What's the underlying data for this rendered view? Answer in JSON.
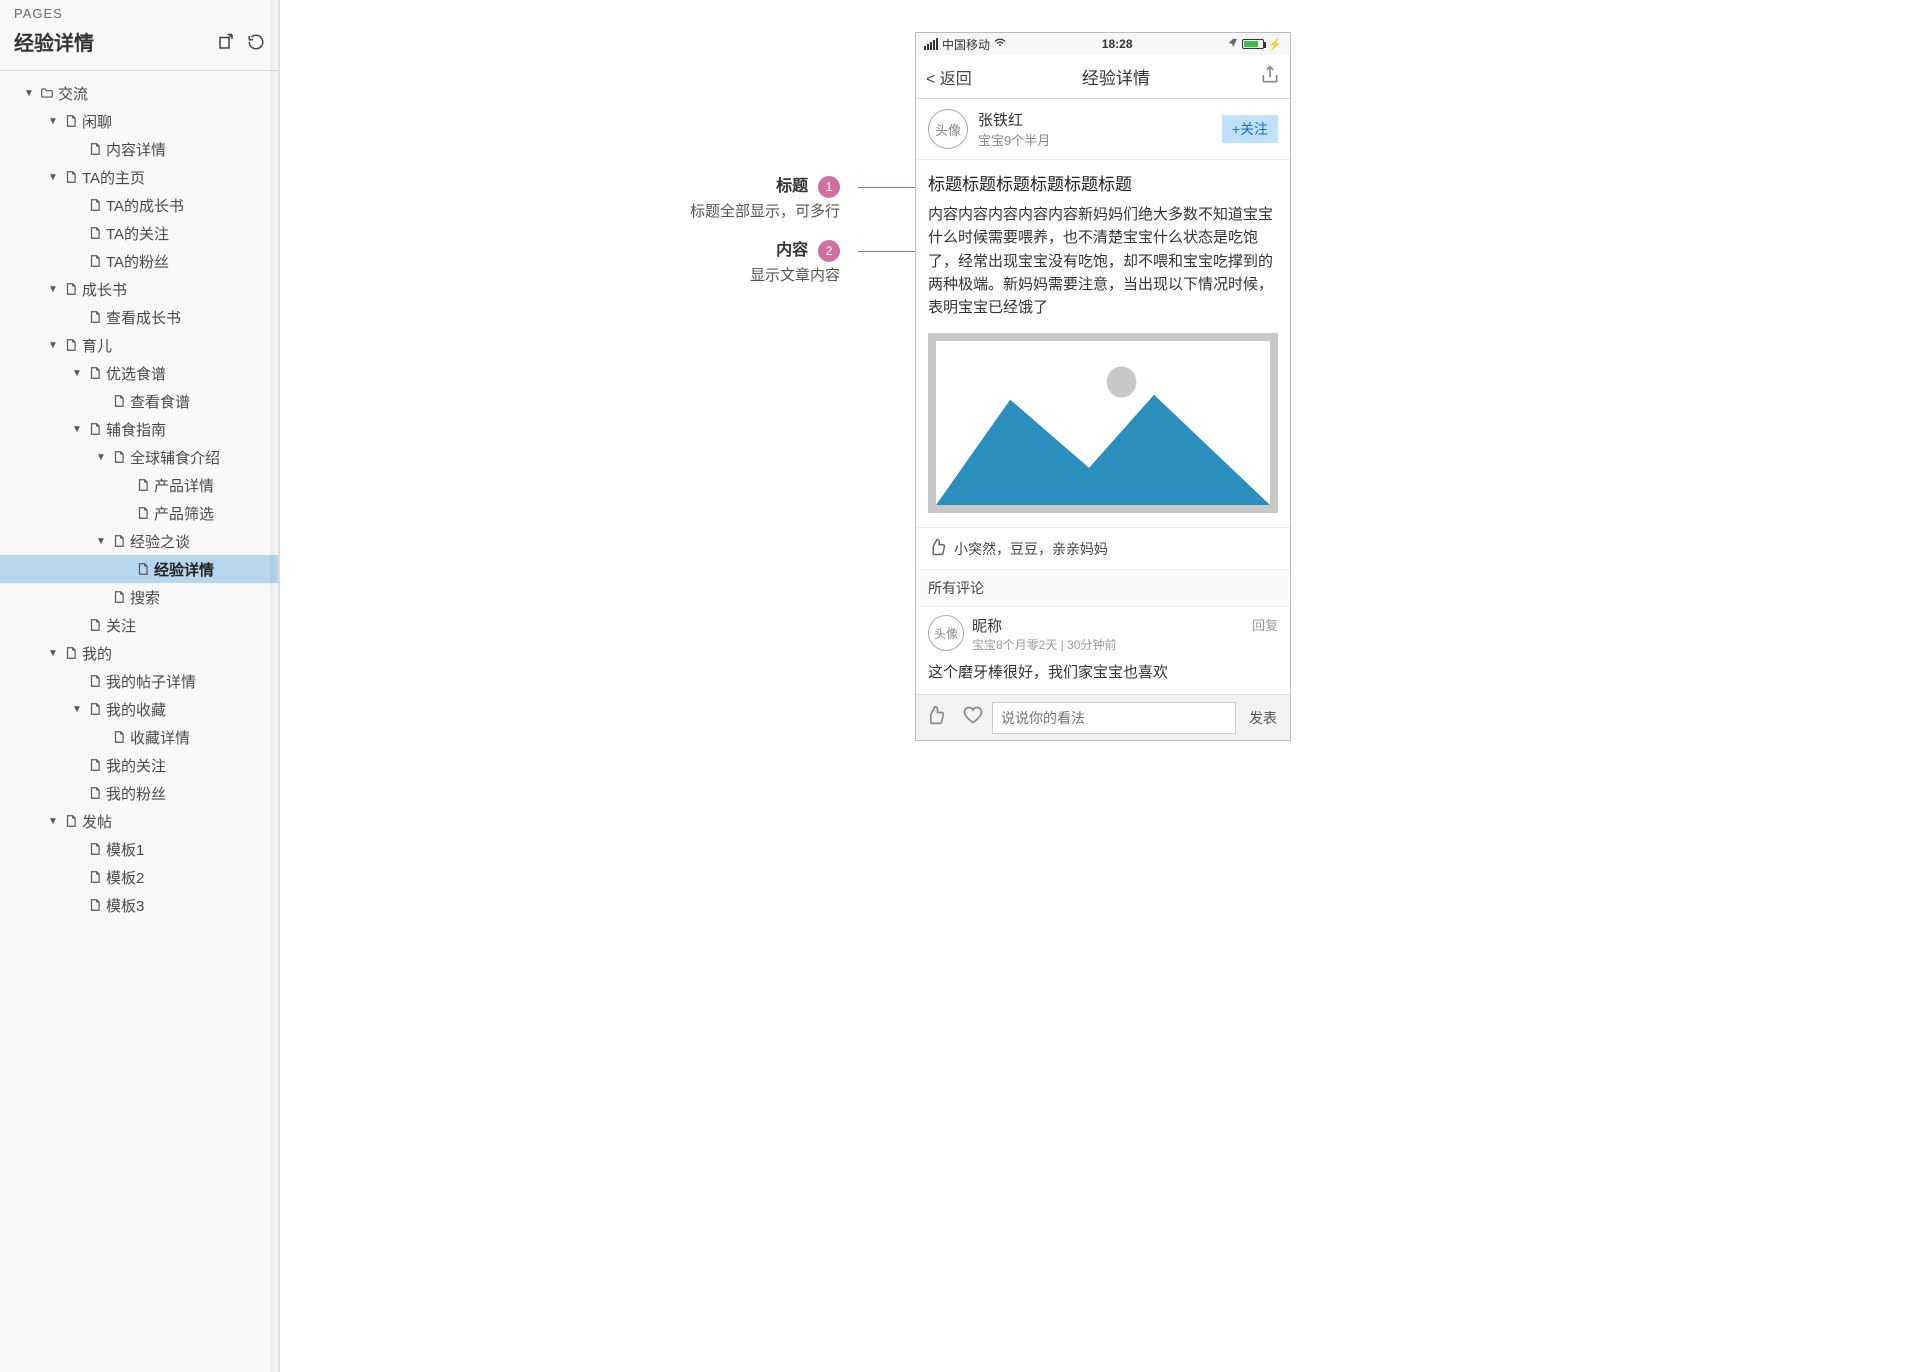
{
  "sidebar": {
    "pages_label": "PAGES",
    "page_title": "经验详情",
    "tree": [
      {
        "depth": 0,
        "caret": true,
        "kind": "folder",
        "label": "交流"
      },
      {
        "depth": 1,
        "caret": true,
        "kind": "page",
        "label": "闲聊"
      },
      {
        "depth": 2,
        "caret": false,
        "kind": "page",
        "label": "内容详情"
      },
      {
        "depth": 1,
        "caret": true,
        "kind": "page",
        "label": "TA的主页"
      },
      {
        "depth": 2,
        "caret": false,
        "kind": "page",
        "label": "TA的成长书"
      },
      {
        "depth": 2,
        "caret": false,
        "kind": "page",
        "label": "TA的关注"
      },
      {
        "depth": 2,
        "caret": false,
        "kind": "page",
        "label": "TA的粉丝"
      },
      {
        "depth": 1,
        "caret": true,
        "kind": "page",
        "label": "成长书"
      },
      {
        "depth": 2,
        "caret": false,
        "kind": "page",
        "label": "查看成长书"
      },
      {
        "depth": 1,
        "caret": true,
        "kind": "page",
        "label": "育儿"
      },
      {
        "depth": 2,
        "caret": true,
        "kind": "page",
        "label": "优选食谱"
      },
      {
        "depth": 3,
        "caret": false,
        "kind": "page",
        "label": "查看食谱"
      },
      {
        "depth": 2,
        "caret": true,
        "kind": "page",
        "label": "辅食指南"
      },
      {
        "depth": 3,
        "caret": true,
        "kind": "page",
        "label": "全球辅食介绍"
      },
      {
        "depth": 4,
        "caret": false,
        "kind": "page",
        "label": "产品详情"
      },
      {
        "depth": 4,
        "caret": false,
        "kind": "page",
        "label": "产品筛选"
      },
      {
        "depth": 3,
        "caret": true,
        "kind": "page",
        "label": "经验之谈"
      },
      {
        "depth": 4,
        "caret": false,
        "kind": "page",
        "label": "经验详情",
        "selected": true
      },
      {
        "depth": 3,
        "caret": false,
        "kind": "page",
        "label": "搜索"
      },
      {
        "depth": 2,
        "caret": false,
        "kind": "page",
        "label": "关注"
      },
      {
        "depth": 1,
        "caret": true,
        "kind": "page",
        "label": "我的"
      },
      {
        "depth": 2,
        "caret": false,
        "kind": "page",
        "label": "我的帖子详情"
      },
      {
        "depth": 2,
        "caret": true,
        "kind": "page",
        "label": "我的收藏"
      },
      {
        "depth": 3,
        "caret": false,
        "kind": "page",
        "label": "收藏详情"
      },
      {
        "depth": 2,
        "caret": false,
        "kind": "page",
        "label": "我的关注"
      },
      {
        "depth": 2,
        "caret": false,
        "kind": "page",
        "label": "我的粉丝"
      },
      {
        "depth": 1,
        "caret": true,
        "kind": "page",
        "label": "发帖"
      },
      {
        "depth": 2,
        "caret": false,
        "kind": "page",
        "label": "模板1"
      },
      {
        "depth": 2,
        "caret": false,
        "kind": "page",
        "label": "模板2"
      },
      {
        "depth": 2,
        "caret": false,
        "kind": "page",
        "label": "模板3"
      }
    ]
  },
  "annotations": [
    {
      "num": "1",
      "title": "标题",
      "sub": "标题全部显示，可多行"
    },
    {
      "num": "2",
      "title": "内容",
      "sub": "显示文章内容"
    }
  ],
  "phone": {
    "status": {
      "carrier": "中国移动",
      "time": "18:28"
    },
    "nav": {
      "back": "< 返回",
      "title": "经验详情"
    },
    "author": {
      "avatar_label": "头像",
      "name": "张铁红",
      "sub": "宝宝9个半月",
      "follow": "+关注"
    },
    "article": {
      "title": "标题标题标题标题标题标题",
      "body": "内容内容内容内容内容新妈妈们绝大多数不知道宝宝什么时候需要喂养，也不清楚宝宝什么状态是吃饱了，经常出现宝宝没有吃饱，却不喂和宝宝吃撑到的两种极端。新妈妈需要注意，当出现以下情况时候，表明宝宝已经饿了"
    },
    "likes": "小突然，豆豆，亲亲妈妈",
    "comments_header": "所有评论",
    "comment": {
      "avatar_label": "头像",
      "name": "昵称",
      "meta": "宝宝8个月零2天 | 30分钟前",
      "reply": "回复",
      "body": "这个磨牙棒很好，我们家宝宝也喜欢"
    },
    "input": {
      "placeholder": "说说你的看法",
      "post": "发表"
    }
  }
}
